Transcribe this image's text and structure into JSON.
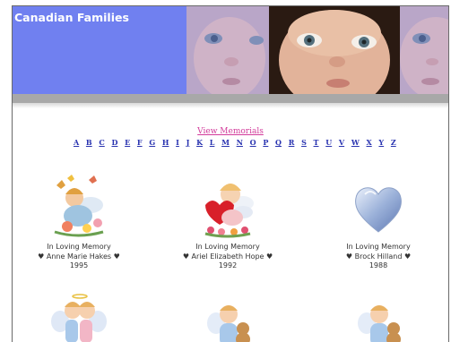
{
  "header": {
    "title": "Canadian Families"
  },
  "nav": {
    "view_memorials": "View Memorials",
    "letters": [
      "A",
      "B",
      "C",
      "D",
      "E",
      "F",
      "G",
      "H",
      "I",
      "J",
      "K",
      "L",
      "M",
      "N",
      "O",
      "P",
      "Q",
      "R",
      "S",
      "T",
      "U",
      "V",
      "W",
      "X",
      "Y",
      "Z"
    ]
  },
  "memorials": [
    {
      "heading": "In Loving Memory",
      "name": "♥ Anne Marie Hakes ♥",
      "year": "1995",
      "art": "angel-with-butterflies"
    },
    {
      "heading": "In Loving Memory",
      "name": "♥ Ariel Elizabeth Hope ♥",
      "year": "1992",
      "art": "angel-with-heart"
    },
    {
      "heading": "In Loving Memory",
      "name": "♥ Brock Hilland ♥",
      "year": "1988",
      "art": "heart"
    }
  ],
  "colors": {
    "banner": "#7080f0",
    "link_pink": "#d23a9a",
    "letters_blue": "#2a34b0"
  }
}
